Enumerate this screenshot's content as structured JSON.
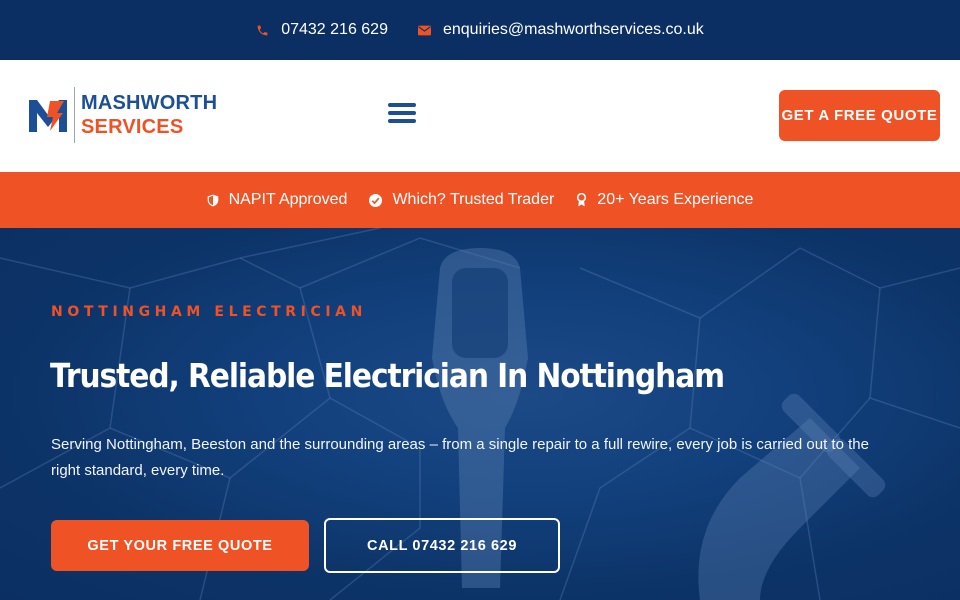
{
  "topbar": {
    "phone": "07432 216 629",
    "email": "enquiries@mashworthservices.co.uk",
    "phone_icon": "phone-icon",
    "email_icon": "envelope-icon"
  },
  "header": {
    "logo": {
      "line1": "MASHWORTH",
      "line2": "SERVICES"
    },
    "menu_icon": "hamburger-menu-icon",
    "quote_button": "GET A FREE QUOTE"
  },
  "trust": [
    {
      "label": "NAPIT Approved",
      "icon": "shield-icon"
    },
    {
      "label": "Which? Trusted Trader",
      "icon": "check-circle-icon"
    },
    {
      "label": "20+ Years Experience",
      "icon": "award-icon"
    }
  ],
  "hero": {
    "eyebrow": "NOTTINGHAM ELECTRICIAN",
    "title": "Trusted, Reliable Electrician In Nottingham",
    "text": "Serving Nottingham, Beeston and the surrounding areas – from a single repair to a full rewire, every job is carried out to the right standard, every time.",
    "primary_cta": "GET YOUR FREE QUOTE",
    "secondary_cta": "CALL 07432 216 629"
  },
  "colors": {
    "navy": "#0b2f63",
    "brand_blue": "#1c4f95",
    "accent_orange": "#ef5325",
    "white": "#ffffff"
  }
}
